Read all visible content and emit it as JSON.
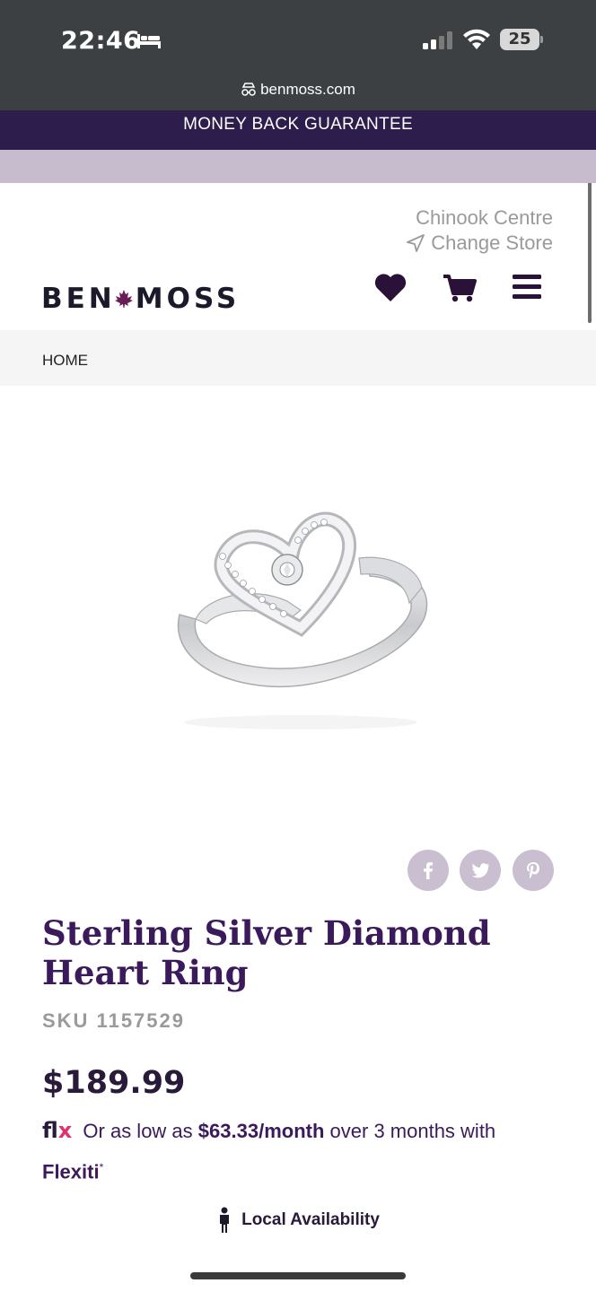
{
  "status_bar": {
    "time": "22:46",
    "battery": "25"
  },
  "browser": {
    "url": "benmoss.com"
  },
  "promo": {
    "text": "MONEY BACK GUARANTEE"
  },
  "header": {
    "store_name": "Chinook Centre",
    "change_store_label": "Change Store",
    "logo_left": "BEN",
    "logo_right": "MOSS",
    "icons": [
      "heart-icon",
      "cart-icon",
      "menu-icon"
    ]
  },
  "breadcrumb": {
    "home": "HOME"
  },
  "share": {
    "icons": [
      "facebook-icon",
      "twitter-icon",
      "pinterest-icon"
    ],
    "color": "#c9bfd0"
  },
  "product": {
    "title": "Sterling Silver Diamond Heart Ring",
    "sku": "SKU 1157529",
    "price": "$189.99",
    "financing": {
      "logo_a": "fl",
      "logo_b": "x",
      "prefix": "Or as low as",
      "amount": "$63.33/month",
      "suffix": "over 3 months with",
      "brand": "Flexiti",
      "mark": "*"
    },
    "local_availability": "Local Availability"
  },
  "colors": {
    "promo_bg": "#2c1d4c",
    "accent_purple": "#3b1a5c",
    "promo_sub_bg": "#c7bccd"
  }
}
